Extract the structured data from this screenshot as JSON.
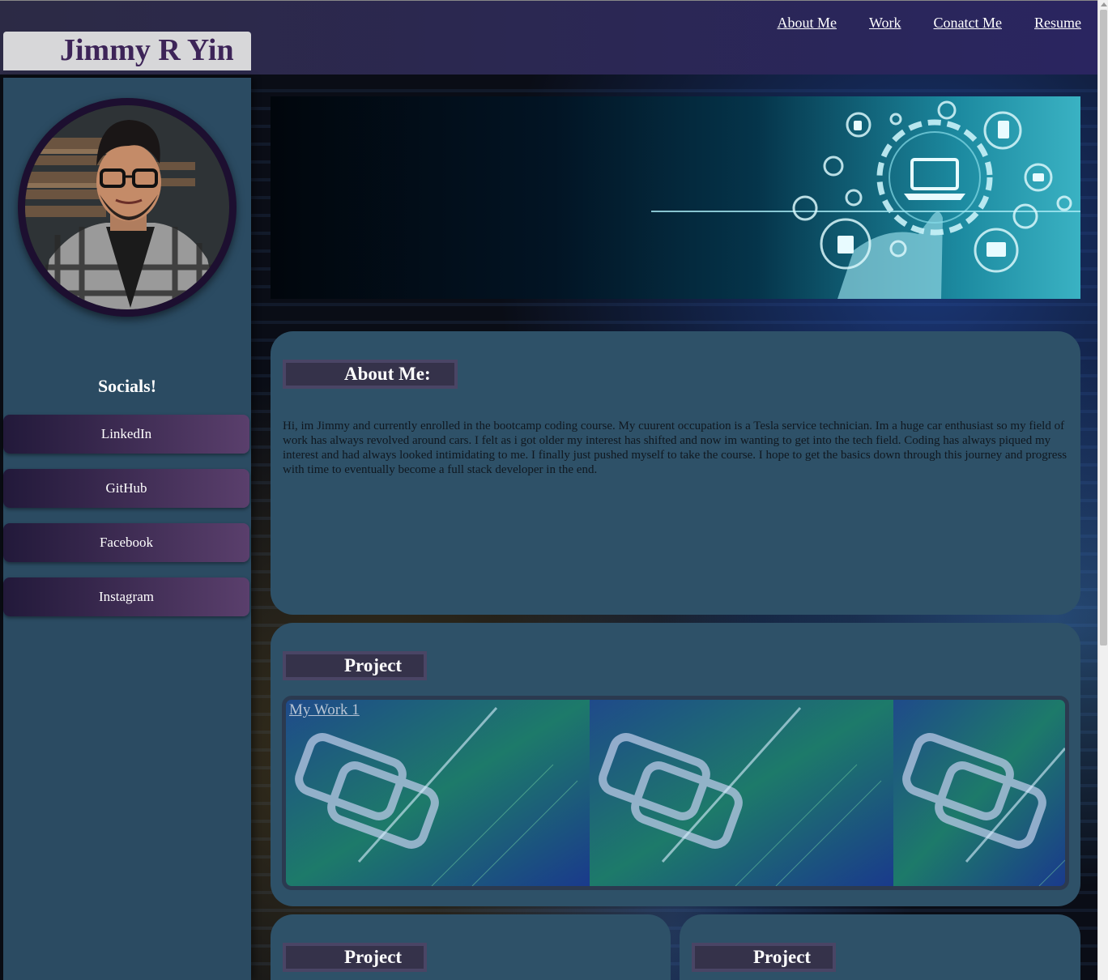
{
  "header": {
    "brand": "Jimmy R Yin",
    "nav": [
      "About Me",
      "Work",
      "Conatct Me",
      "Resume"
    ]
  },
  "sidebar": {
    "socials_title": "Socials!",
    "links": [
      "LinkedIn",
      "GitHub",
      "Facebook",
      "Instagram"
    ]
  },
  "about": {
    "title": "About Me:",
    "text": "Hi, im Jimmy and currently enrolled in the bootcamp coding course. My cuurent occupation is a Tesla service technician. Im a huge car enthusiast so my field of work has always revolved around cars. I felt as i got older my interest has shifted and now im wanting to get into the tech field. Coding has always piqued my interest and had always looked intimidating to me. I finally just pushed myself to take the course. I hope to get the basics down through this journey and progress with time to eventually become a full stack developer in the end."
  },
  "projects": {
    "main_title": "Project",
    "main_link": "My Work 1",
    "secondary_titles": [
      "Project",
      "Project"
    ]
  },
  "colors": {
    "topbar": "#2a2560",
    "sidebar": "#2b4b62",
    "panel": "#2e5168",
    "brand_text": "#3d2458"
  }
}
